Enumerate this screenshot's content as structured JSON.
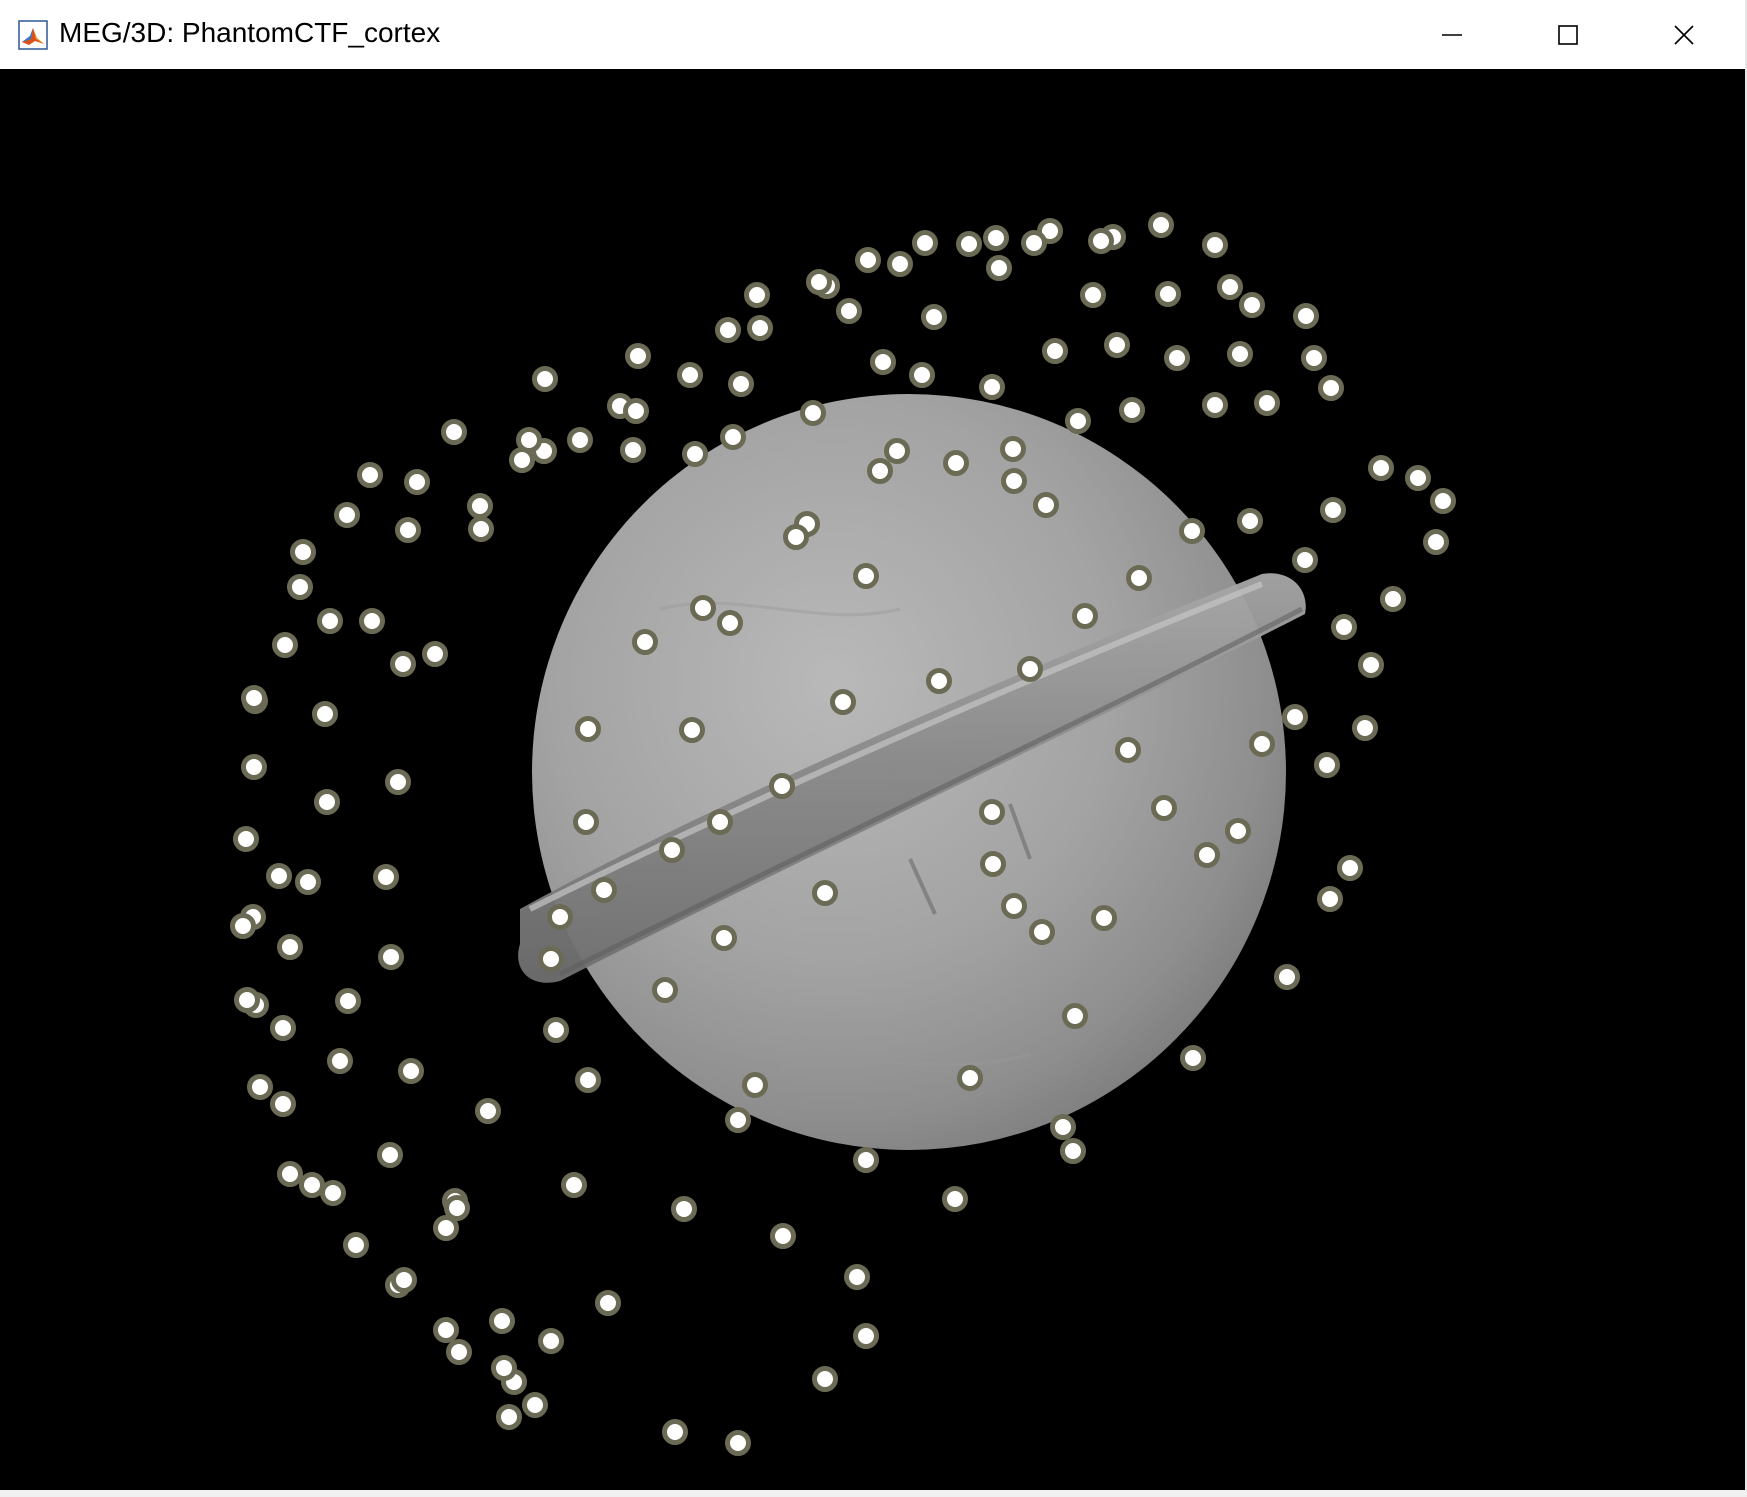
{
  "window": {
    "title": "MEG/3D: PhantomCTF_cortex",
    "app_icon": "matlab-icon",
    "controls": {
      "minimize_icon": "minimize-icon",
      "maximize_icon": "maximize-icon",
      "close_icon": "close-icon"
    }
  },
  "scene": {
    "background_color": "#000000",
    "surface": "PhantomCTF_cortex",
    "surface_color": "#a8a8a8",
    "sensor_marker_ring_color": "#6b6b55",
    "sensor_marker_fill_color": "#ffffff"
  }
}
